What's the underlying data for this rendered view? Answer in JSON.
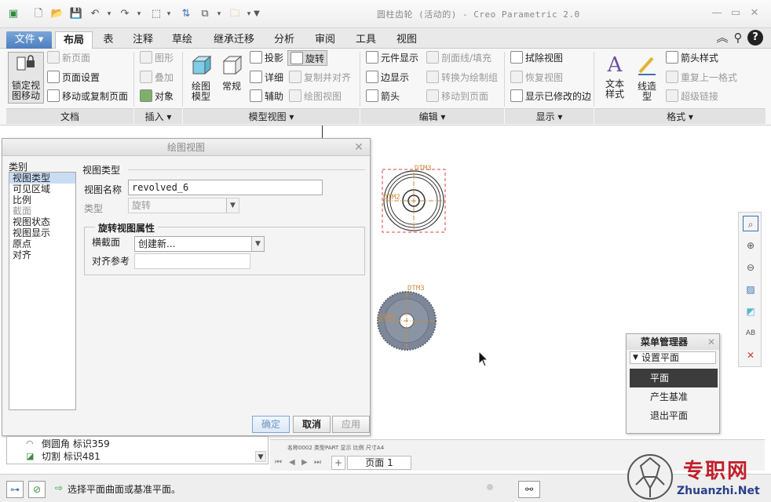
{
  "window": {
    "title": "圆柱齿轮 (活动的) - Creo Parametric 2.0"
  },
  "tabs": [
    {
      "label": "文件 ▾",
      "active": false
    },
    {
      "label": "布局",
      "active": true
    },
    {
      "label": "表",
      "active": false
    },
    {
      "label": "注释",
      "active": false
    },
    {
      "label": "草绘",
      "active": false
    },
    {
      "label": "继承迁移",
      "active": false
    },
    {
      "label": "分析",
      "active": false
    },
    {
      "label": "审阅",
      "active": false
    },
    {
      "label": "工具",
      "active": false
    },
    {
      "label": "视图",
      "active": false
    }
  ],
  "ribbon": {
    "document": {
      "lock_move": "锁定视\n图移动",
      "new_page": "新页面",
      "page_setup": "页面设置",
      "move_copy_page": "移动或复制页面",
      "group_label": "文档"
    },
    "insert": {
      "graphics": "图形",
      "overlay": "叠加",
      "object": "对象",
      "group_label": "插入 ▾"
    },
    "model_views": {
      "drawing_model": "绘图\n模型",
      "general": "常规",
      "projection": "投影",
      "detailed": "详细",
      "auxiliary": "辅助",
      "revolved": "旋转",
      "copy_align": "复制并对齐",
      "drawing_view": "绘图视图",
      "group_label": "模型视图 ▾"
    },
    "edit": {
      "component_display": "元件显示",
      "edge_display": "边显示",
      "arrow": "箭头",
      "xhatch": "剖面线/填充",
      "convert_draw_group": "转换为绘制组",
      "move_to_page": "移动到页面",
      "group_label": "编辑 ▾"
    },
    "display": {
      "erase_view": "拭除视图",
      "restore_view": "恢复视图",
      "show_modified_edges": "显示已修改的边",
      "group_label": "显示 ▾"
    },
    "format": {
      "text_style": "文本\n样式",
      "line_style": "线造\n型",
      "arrow_style": "箭头样式",
      "repeat_last_format": "重复上一格式",
      "hyperlink": "超级链接",
      "group_label": "格式 ▾"
    }
  },
  "dialog": {
    "title": "绘图视图",
    "categories_label": "类别",
    "categories": [
      {
        "label": "视图类型",
        "selected": true,
        "disabled": false
      },
      {
        "label": "可见区域",
        "selected": false,
        "disabled": false
      },
      {
        "label": "比例",
        "selected": false,
        "disabled": false
      },
      {
        "label": "截面",
        "selected": false,
        "disabled": true
      },
      {
        "label": "视图状态",
        "selected": false,
        "disabled": false
      },
      {
        "label": "视图显示",
        "selected": false,
        "disabled": false
      },
      {
        "label": "原点",
        "selected": false,
        "disabled": false
      },
      {
        "label": "对齐",
        "selected": false,
        "disabled": false
      }
    ],
    "section_title": "视图类型",
    "view_name_label": "视图名称",
    "view_name_value": "revolved_6",
    "type_label": "类型",
    "type_value": "旋转",
    "revolve_props_title": "旋转视图属性",
    "xsec_label": "横截面",
    "xsec_value": "创建新...",
    "align_ref_label": "对齐参考",
    "align_ref_value": "",
    "ok": "确定",
    "cancel": "取消",
    "apply": "应用"
  },
  "drawing": {
    "datum_top_1": "DTM3",
    "datum_side_1": "DTM2",
    "datum_top_2": "DTM3",
    "datum_side_2": "DTM2"
  },
  "tree": {
    "rows": [
      {
        "text": "倒圆角 标识359"
      },
      {
        "text": "切割 标识481"
      }
    ]
  },
  "sheets": {
    "page_label": "页面 1",
    "tiny_info": "名称0002   类型PART   显示 比例   尺寸A4"
  },
  "status": {
    "message": "选择平面曲面或基准平面。"
  },
  "menu_manager": {
    "title": "菜单管理器",
    "sub": "设置平面",
    "items": [
      {
        "label": "平面",
        "selected": true
      },
      {
        "label": "产生基准",
        "selected": false
      },
      {
        "label": "退出平面",
        "selected": false
      }
    ]
  },
  "watermark": {
    "big": "专职网",
    "small": "Zhuanzhi.Net"
  },
  "colors": {
    "accent": "#4d7fbf",
    "selection": "#c8dcf4",
    "datum_label": "#d08a3a",
    "selected_view_dash": "#e04040",
    "gear_fill": "#7d8797"
  }
}
